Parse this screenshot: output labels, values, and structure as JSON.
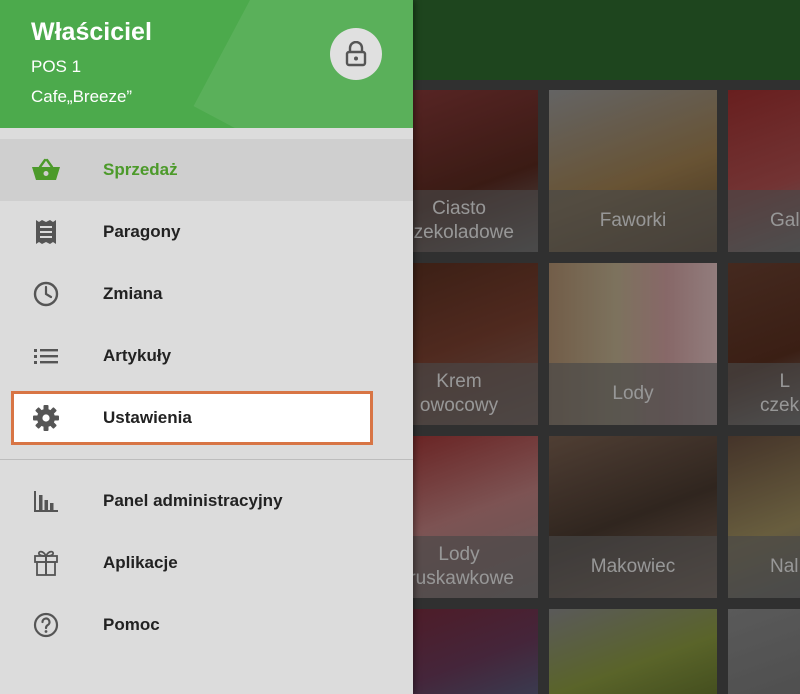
{
  "header": {
    "owner": "Właściciel",
    "pos": "POS 1",
    "cafe": "Cafe„Breeze”"
  },
  "menu": {
    "sales": "Sprzedaż",
    "receipts": "Paragony",
    "shift": "Zmiana",
    "items": "Artykuły",
    "settings": "Ustawienia",
    "admin": "Panel administracyjny",
    "apps": "Aplikacje",
    "help": "Pomoc"
  },
  "products": [
    {
      "label": "Ciasto\nczekoladowe"
    },
    {
      "label": "Faworki"
    },
    {
      "label": "Gal"
    },
    {
      "label": "Krem\nowocowy"
    },
    {
      "label": "Lody"
    },
    {
      "label": "L\nczeko"
    },
    {
      "label": "Lody\ntruskawkowe"
    },
    {
      "label": "Makowiec"
    },
    {
      "label": "Nal"
    }
  ],
  "colors": {
    "header": "#4caa4c",
    "accent": "#4c9a2a",
    "highlight_border": "#d87545"
  }
}
